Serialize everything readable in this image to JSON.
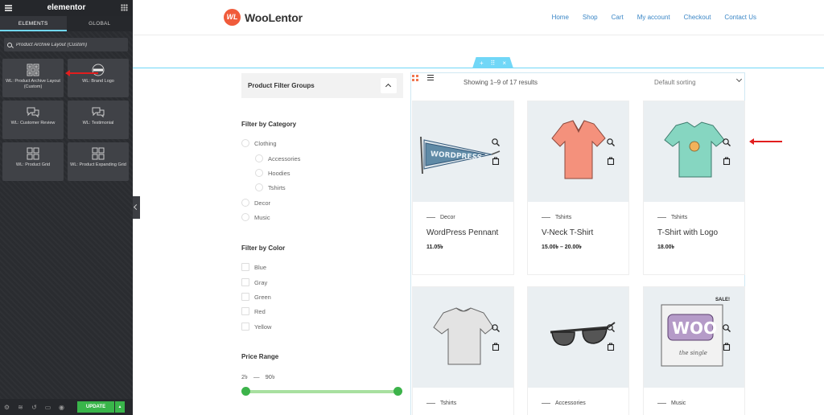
{
  "sidebar": {
    "logo": "elementor",
    "tabs": [
      "ELEMENTS",
      "GLOBAL"
    ],
    "search_value": "Product Archive Layout (Custom)",
    "widgets": [
      {
        "label": "WL: Product Archive Layout (Custom)",
        "icon": "archive-grid-icon"
      },
      {
        "label": "WL: Brand Logo",
        "icon": "brand-logo-icon"
      },
      {
        "label": "WL: Customer Review",
        "icon": "speech-bubbles-icon"
      },
      {
        "label": "WL: Testimonial",
        "icon": "speech-bubbles-icon"
      },
      {
        "label": "WL: Product Grid",
        "icon": "product-grid-icon"
      },
      {
        "label": "WL: Product Expanding Grid",
        "icon": "product-grid-icon"
      }
    ],
    "footer": {
      "update_label": "UPDATE"
    }
  },
  "header": {
    "logo_mark": "WL",
    "logo_text": "WooLentor",
    "nav": [
      "Home",
      "Shop",
      "Cart",
      "My account",
      "Checkout",
      "Contact Us"
    ]
  },
  "section_handle": {
    "add": "+",
    "move": "⠿",
    "close": "×"
  },
  "filters": {
    "groups_title": "Product Filter Groups",
    "category_heading": "Filter by Category",
    "categories": [
      "Clothing",
      "Accessories",
      "Hoodies",
      "Tshirts",
      "Decor",
      "Music"
    ],
    "color_heading": "Filter by Color",
    "colors": [
      "Blue",
      "Gray",
      "Green",
      "Red",
      "Yellow"
    ],
    "price_heading": "Price Range",
    "price_min": "2৳",
    "price_sep": "—",
    "price_max": "90৳"
  },
  "shop": {
    "result_count": "Showing 1–9 of 17 results",
    "sort": "Default sorting",
    "products": [
      {
        "category": "Decor",
        "name": "WordPress Pennant",
        "price": "11.05৳",
        "image": "pennant"
      },
      {
        "category": "Tshirts",
        "name": "V-Neck T-Shirt",
        "price": "15.00৳ – 20.00৳",
        "image": "vneck"
      },
      {
        "category": "Tshirts",
        "name": "T-Shirt with Logo",
        "price": "18.00৳",
        "image": "logo-tee"
      },
      {
        "category": "Tshirts",
        "name": "",
        "price": "",
        "image": "gray-tee"
      },
      {
        "category": "Accessories",
        "name": "",
        "price": "",
        "image": "sunglasses"
      },
      {
        "category": "Music",
        "name": "",
        "price": "",
        "image": "album",
        "badge": "SALE!"
      }
    ]
  },
  "colors": {
    "accent": "#71d7f7",
    "brand": "#f05b3b",
    "link": "#3a86c6",
    "update": "#39b54a",
    "slider": "#3cb34a",
    "arrow": "#e21e1e"
  }
}
